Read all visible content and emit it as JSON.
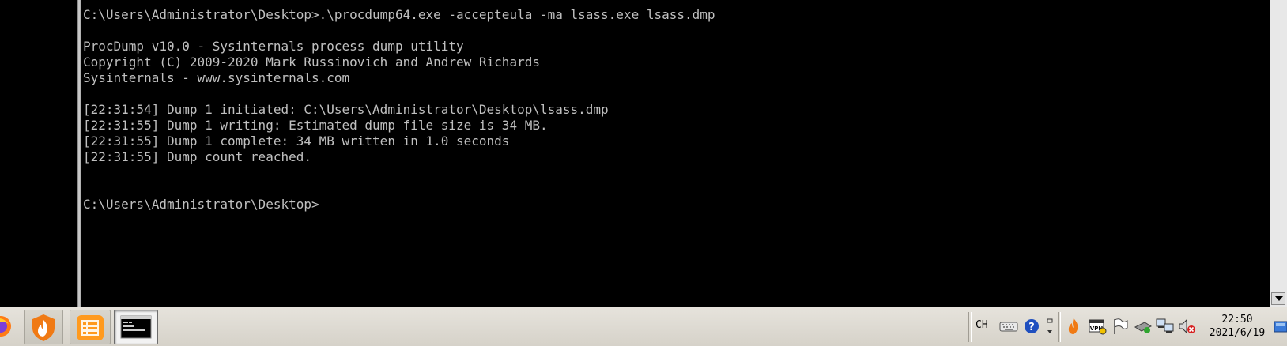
{
  "console": {
    "lines": [
      "C:\\Users\\Administrator\\Desktop>.\\procdump64.exe -accepteula -ma lsass.exe lsass.dmp",
      "",
      "ProcDump v10.0 - Sysinternals process dump utility",
      "Copyright (C) 2009-2020 Mark Russinovich and Andrew Richards",
      "Sysinternals - www.sysinternals.com",
      "",
      "[22:31:54] Dump 1 initiated: C:\\Users\\Administrator\\Desktop\\lsass.dmp",
      "[22:31:55] Dump 1 writing: Estimated dump file size is 34 MB.",
      "[22:31:55] Dump 1 complete: 34 MB written in 1.0 seconds",
      "[22:31:55] Dump count reached.",
      "",
      "",
      "C:\\Users\\Administrator\\Desktop>"
    ]
  },
  "taskbar": {
    "apps": [
      {
        "name": "firefox-icon"
      },
      {
        "name": "huorong-icon"
      },
      {
        "name": "notes-icon"
      },
      {
        "name": "cmd-icon"
      }
    ],
    "tray": {
      "language": "CH",
      "icons": [
        "keyboard-icon",
        "help-icon",
        "options-icon",
        "huorong-tray-icon",
        "vpn-icon",
        "flag-icon",
        "usb-icon",
        "network-icon",
        "volume-muted-icon"
      ]
    },
    "clock": {
      "time": "22:50",
      "date": "2021/6/19"
    }
  },
  "colors": {
    "console_bg": "#000000",
    "console_fg": "#c0c0c0",
    "taskbar_bg": "#d6d2c9"
  }
}
